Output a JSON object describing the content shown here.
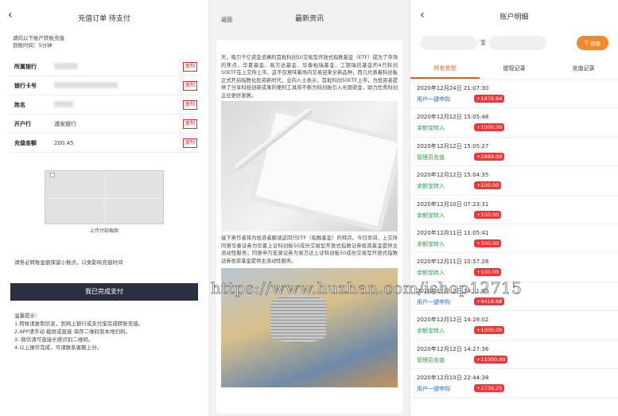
{
  "recharge": {
    "back_icon": "chevron-left-icon",
    "title": "充值订单 待支付",
    "hint_line1": "请向以下账户转账充值",
    "hint_line2": "到账时间：5分钟",
    "rows": [
      {
        "label": "所属银行",
        "value": "",
        "copy": "复制"
      },
      {
        "label": "银行卡号",
        "value": "",
        "copy": "复制"
      },
      {
        "label": "姓名",
        "value": "",
        "copy": "复制"
      },
      {
        "label": "开户行",
        "value": "浦发银行",
        "copy": "复制"
      },
      {
        "label": "充值金额",
        "value": "200.45",
        "copy": "复制"
      }
    ],
    "upload_caption": "上传付款截图",
    "warning": "请务必转账金额保留小数点，以免影响充值时间",
    "done_button": "我已完成支付",
    "tips_title": "温馨提示：",
    "tips": [
      "1.转账请复制信息，到网上银行或支付宝完成转账充值。",
      "2.APP请手动 截屏或直接 保存二维码到本地扫码。",
      "3. 微信请可直接长按识别二维码。",
      "4.以上操作完成，可请联系客服上分。"
    ]
  },
  "news": {
    "back_label": "返回",
    "title": "最新资讯",
    "para1": "天，吸引千亿资金追捧的首批科创50交易型开放式指数基金（ETF）成为了市场的焦点，华夏基金、易方达基金、华泰柏瑞基金、工银瑞信基金的4只科创50ETF在上交所上市，这不仅意味着场内交易迎来全新品种，而几代表着科创板正式开启指数化投资新时代，业内人士表示，首批科创50ETF上市，为投资者提供了分享科技创新成果的便利工具将不断为科创板引入长期资金，助力优秀科创企业更好发展。",
    "para2": "接下来作者将为投资者解读这四只ETF（指数基金）的特点。今日早间，上交所同意华泰证券为华夏上证科创板50成份交易型开放式指数证券投资基金提供主流动性服务；同意申万宏源证券为易方达上证科创板50成份交易型开放式指数证券投资基金提供主流动性服务。"
  },
  "ledger": {
    "back_icon": "chevron-left-icon",
    "title": "账户明细",
    "to_label": "至",
    "search_label": "搜索",
    "tabs": [
      "所有类型",
      "提现记录",
      "充值记录"
    ],
    "records": [
      {
        "date": "2020年12月24日 21:07:30",
        "type": "用户一键申购",
        "amount": "+1878.94",
        "color": "blue"
      },
      {
        "date": "2020年12月12日 15:05:48",
        "type": "余额宝转入",
        "amount": "+1000.00",
        "color": "green"
      },
      {
        "date": "2020年12月12日 15:05:27",
        "type": "管理员充值",
        "amount": "+2889.00",
        "color": "green"
      },
      {
        "date": "2020年12月12日 15:04:35",
        "type": "余额宝转入",
        "amount": "+100.00",
        "color": "green"
      },
      {
        "date": "2020年12月10日 07:23:31",
        "type": "余额宝转入",
        "amount": "+100.00",
        "color": "green"
      },
      {
        "date": "2020年12月11日 11:05:41",
        "type": "余额宝转入",
        "amount": "+300.00",
        "color": "green"
      },
      {
        "date": "2020年12月11日 10:57:28",
        "type": "余额宝转入",
        "amount": "+100.00",
        "color": "green"
      },
      {
        "date": "2020年12月12日 14:31:05",
        "type": "用户一键申购",
        "amount": "+9418.68",
        "color": "blue"
      },
      {
        "date": "2020年12月12日 14:28:02",
        "type": "余额宝转入",
        "amount": "+1000.00",
        "color": "green"
      },
      {
        "date": "2020年12月12日 14:27:36",
        "type": "管理员充值",
        "amount": "+11000.00",
        "color": "green"
      },
      {
        "date": "2020年12月10日 22:44:38",
        "type": "用户一键申购",
        "amount": "+2738.25",
        "color": "blue"
      }
    ]
  },
  "watermark": "https://www.huzhan.com/ishop12715"
}
